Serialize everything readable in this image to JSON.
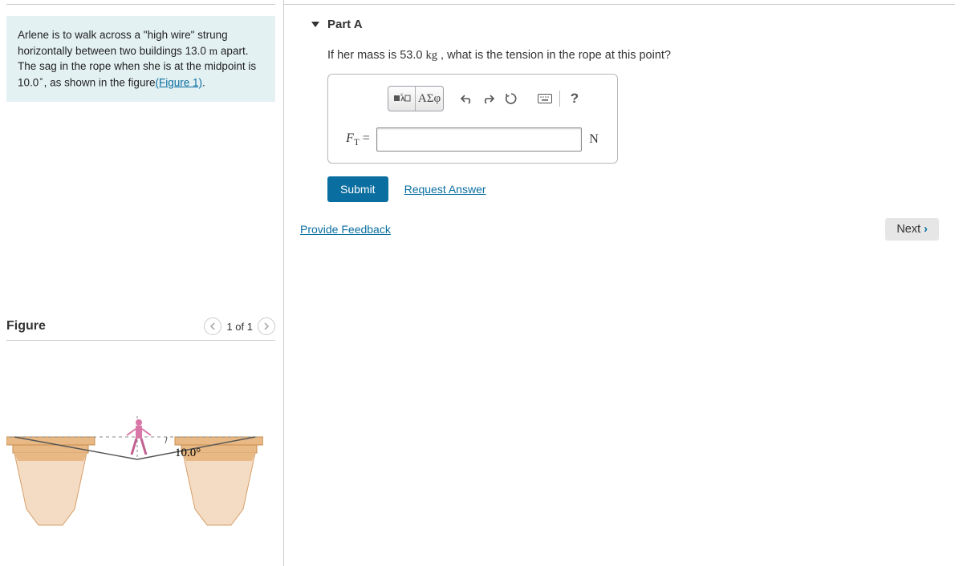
{
  "intro": {
    "text_1": "Arlene is to walk across a \"high wire\" strung horizontally between two buildings 13.0 ",
    "unit_m": "m",
    "text_2": " apart. The sag in the rope when she is at the midpoint is 10.0",
    "deg": "∘",
    "text_3": ", as shown in the figure",
    "fig_link": "(Figure 1)",
    "text_4": "."
  },
  "figure": {
    "title": "Figure",
    "pager": "1 of 1",
    "angle_label": "10.0°"
  },
  "part": {
    "title": "Part A",
    "question_1": "If her mass is 53.0 ",
    "mass_unit": "kg",
    "question_2": " , what is the tension in the rope at this point?",
    "toolbar": {
      "templates_label": "▪√x",
      "greek_label": "ΑΣφ"
    },
    "lhs_var": "F",
    "lhs_sub": "T",
    "lhs_eq": " =",
    "input_value": "",
    "unit": "N",
    "submit_label": "Submit",
    "request_label": "Request Answer"
  },
  "footer": {
    "feedback_label": "Provide Feedback",
    "next_label": "Next"
  }
}
